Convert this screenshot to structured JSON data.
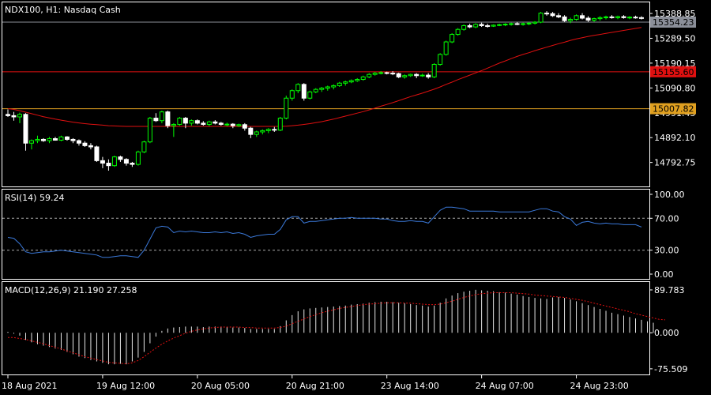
{
  "chart_data": [
    {
      "type": "candlestick",
      "panel": "price",
      "title": "NDX100, H1:  Nasdaq Cash",
      "yrange": [
        14700,
        15430
      ],
      "yticks": [
        "15388.85",
        "15289.50",
        "15190.15",
        "15090.80",
        "14991.45",
        "14892.10",
        "14792.75"
      ],
      "hlines": [
        {
          "label": "15354.23",
          "value": 15354.23,
          "color": "#8b8f99",
          "tag_bg": "#8b8f99",
          "tag_fg": "#000000"
        },
        {
          "label": "15155.60",
          "value": 15155.6,
          "color": "#e01010",
          "tag_bg": "#e01010",
          "tag_fg": "#000000"
        },
        {
          "label": "15007.82",
          "value": 15007.82,
          "color": "#e0a020",
          "tag_bg": "#e0a020",
          "tag_fg": "#000000"
        }
      ],
      "ma_color": "#e01010",
      "candle_up_color": "#00ff00",
      "candle_down_color": "#ffffff",
      "candles_ohlc": [
        [
          14985,
          15005,
          14975,
          14980
        ],
        [
          14980,
          14995,
          14960,
          14975
        ],
        [
          14975,
          14992,
          14950,
          14985
        ],
        [
          14985,
          14990,
          14840,
          14870
        ],
        [
          14870,
          14885,
          14845,
          14880
        ],
        [
          14880,
          14900,
          14870,
          14885
        ],
        [
          14885,
          14890,
          14875,
          14880
        ],
        [
          14880,
          14895,
          14870,
          14888
        ],
        [
          14888,
          14895,
          14880,
          14882
        ],
        [
          14882,
          14900,
          14878,
          14895
        ],
        [
          14895,
          14898,
          14880,
          14885
        ],
        [
          14885,
          14890,
          14870,
          14880
        ],
        [
          14880,
          14885,
          14860,
          14870
        ],
        [
          14870,
          14878,
          14855,
          14860
        ],
        [
          14860,
          14870,
          14845,
          14855
        ],
        [
          14855,
          14860,
          14795,
          14800
        ],
        [
          14800,
          14815,
          14770,
          14790
        ],
        [
          14790,
          14805,
          14760,
          14780
        ],
        [
          14780,
          14820,
          14775,
          14815
        ],
        [
          14815,
          14820,
          14795,
          14805
        ],
        [
          14805,
          14810,
          14780,
          14790
        ],
        [
          14790,
          14795,
          14775,
          14785
        ],
        [
          14785,
          14840,
          14780,
          14835
        ],
        [
          14835,
          14880,
          14830,
          14875
        ],
        [
          14875,
          14975,
          14870,
          14970
        ],
        [
          14970,
          14990,
          14955,
          14960
        ],
        [
          14960,
          15000,
          14950,
          14995
        ],
        [
          14995,
          15000,
          14930,
          14940
        ],
        [
          14940,
          14950,
          14895,
          14945
        ],
        [
          14945,
          14975,
          14940,
          14970
        ],
        [
          14970,
          14975,
          14930,
          14950
        ],
        [
          14950,
          14965,
          14940,
          14960
        ],
        [
          14960,
          14965,
          14945,
          14950
        ],
        [
          14950,
          14958,
          14940,
          14945
        ],
        [
          14945,
          14960,
          14938,
          14955
        ],
        [
          14955,
          14962,
          14945,
          14950
        ],
        [
          14950,
          14955,
          14940,
          14945
        ],
        [
          14945,
          14952,
          14938,
          14946
        ],
        [
          14946,
          14950,
          14930,
          14940
        ],
        [
          14940,
          14948,
          14935,
          14944
        ],
        [
          14944,
          14950,
          14920,
          14930
        ],
        [
          14930,
          14935,
          14890,
          14905
        ],
        [
          14905,
          14920,
          14895,
          14915
        ],
        [
          14915,
          14925,
          14905,
          14920
        ],
        [
          14920,
          14930,
          14910,
          14925
        ],
        [
          14925,
          14935,
          14915,
          14922
        ],
        [
          14922,
          14975,
          14918,
          14970
        ],
        [
          14970,
          15060,
          14965,
          15050
        ],
        [
          15050,
          15085,
          15040,
          15080
        ],
        [
          15080,
          15110,
          15070,
          15105
        ],
        [
          15105,
          15110,
          15040,
          15050
        ],
        [
          15050,
          15080,
          15045,
          15075
        ],
        [
          15075,
          15090,
          15070,
          15085
        ],
        [
          15085,
          15095,
          15075,
          15090
        ],
        [
          15090,
          15100,
          15080,
          15095
        ],
        [
          15095,
          15105,
          15085,
          15100
        ],
        [
          15100,
          15115,
          15095,
          15110
        ],
        [
          15110,
          15120,
          15100,
          15115
        ],
        [
          15115,
          15125,
          15110,
          15120
        ],
        [
          15120,
          15130,
          15115,
          15125
        ],
        [
          15125,
          15140,
          15120,
          15135
        ],
        [
          15135,
          15150,
          15130,
          15145
        ],
        [
          15145,
          15155,
          15140,
          15150
        ],
        [
          15150,
          15158,
          15145,
          15152
        ],
        [
          15152,
          15156,
          15145,
          15150
        ],
        [
          15150,
          15158,
          15142,
          15148
        ],
        [
          15148,
          15152,
          15130,
          15135
        ],
        [
          15135,
          15145,
          15128,
          15140
        ],
        [
          15140,
          15148,
          15135,
          15145
        ],
        [
          15145,
          15150,
          15130,
          15140
        ],
        [
          15140,
          15148,
          15135,
          15142
        ],
        [
          15142,
          15150,
          15128,
          15135
        ],
        [
          15135,
          15190,
          15130,
          15185
        ],
        [
          15185,
          15230,
          15180,
          15225
        ],
        [
          15225,
          15280,
          15220,
          15275
        ],
        [
          15275,
          15310,
          15270,
          15305
        ],
        [
          15305,
          15330,
          15300,
          15325
        ],
        [
          15325,
          15345,
          15320,
          15340
        ],
        [
          15340,
          15348,
          15330,
          15335
        ],
        [
          15335,
          15350,
          15330,
          15345
        ],
        [
          15345,
          15352,
          15335,
          15340
        ],
        [
          15340,
          15348,
          15332,
          15338
        ],
        [
          15338,
          15345,
          15335,
          15342
        ],
        [
          15342,
          15348,
          15338,
          15344
        ],
        [
          15344,
          15350,
          15338,
          15346
        ],
        [
          15346,
          15352,
          15340,
          15348
        ],
        [
          15348,
          15354,
          15342,
          15346
        ],
        [
          15346,
          15352,
          15340,
          15348
        ],
        [
          15348,
          15355,
          15342,
          15350
        ],
        [
          15350,
          15358,
          15345,
          15354
        ],
        [
          15354,
          15395,
          15350,
          15390
        ],
        [
          15390,
          15398,
          15380,
          15388
        ],
        [
          15388,
          15395,
          15375,
          15380
        ],
        [
          15380,
          15390,
          15370,
          15375
        ],
        [
          15375,
          15382,
          15355,
          15360
        ],
        [
          15360,
          15372,
          15350,
          15365
        ],
        [
          15365,
          15385,
          15360,
          15380
        ],
        [
          15380,
          15390,
          15365,
          15370
        ],
        [
          15370,
          15378,
          15355,
          15362
        ],
        [
          15362,
          15372,
          15355,
          15368
        ],
        [
          15368,
          15378,
          15360,
          15372
        ],
        [
          15372,
          15380,
          15365,
          15375
        ],
        [
          15375,
          15382,
          15368,
          15372
        ],
        [
          15372,
          15380,
          15366,
          15376
        ],
        [
          15376,
          15382,
          15368,
          15372
        ],
        [
          15372,
          15378,
          15366,
          15374
        ],
        [
          15374,
          15380,
          15368,
          15372
        ],
        [
          15372,
          15378,
          15365,
          15370
        ]
      ],
      "ma_values": [
        15008,
        15005,
        15000,
        14994,
        14988,
        14982,
        14976,
        14971,
        14966,
        14962,
        14958,
        14954,
        14951,
        14948,
        14946,
        14944,
        14942,
        14940,
        14939,
        14938,
        14937,
        14937,
        14937,
        14937,
        14937,
        14937,
        14937,
        14937,
        14937,
        14937,
        14937,
        14937,
        14937,
        14937,
        14937,
        14937,
        14937,
        14937,
        14937,
        14937,
        14937,
        14937,
        14937,
        14937,
        14937,
        14937,
        14937,
        14938,
        14940,
        14942,
        14945,
        14948,
        14952,
        14956,
        14961,
        14966,
        14972,
        14978,
        14984,
        14990,
        14996,
        15003,
        15010,
        15018,
        15025,
        15032,
        15040,
        15048,
        15056,
        15063,
        15070,
        15078,
        15086,
        15095,
        15105,
        15114,
        15124,
        15133,
        15142,
        15151,
        15160,
        15170,
        15180,
        15190,
        15199,
        15208,
        15217,
        15225,
        15232,
        15240,
        15247,
        15254,
        15261,
        15268,
        15274,
        15281,
        15287,
        15292,
        15297,
        15301,
        15305,
        15309,
        15313,
        15317,
        15321,
        15325,
        15329,
        15333
      ]
    },
    {
      "type": "line",
      "panel": "rsi",
      "title": "RSI(14) 59.24",
      "yrange": [
        0,
        100
      ],
      "yticks": [
        "100.00",
        "70.00",
        "30.00",
        "0.00"
      ],
      "levels": [
        70,
        30
      ],
      "color": "#3a78d8",
      "values": [
        46,
        45,
        38,
        28,
        26,
        27,
        28,
        28,
        29,
        30,
        29,
        28,
        27,
        26,
        25,
        24,
        21,
        21,
        22,
        23,
        23,
        22,
        21,
        30,
        44,
        58,
        60,
        59,
        52,
        54,
        53,
        54,
        53,
        52,
        52,
        53,
        52,
        53,
        51,
        52,
        50,
        46,
        48,
        49,
        50,
        50,
        56,
        68,
        72,
        72,
        64,
        66,
        66,
        67,
        68,
        69,
        70,
        70,
        71,
        70,
        70,
        70,
        70,
        69,
        69,
        67,
        66,
        66,
        67,
        66,
        66,
        64,
        72,
        80,
        84,
        84,
        83,
        82,
        79,
        79,
        79,
        79,
        79,
        78,
        78,
        78,
        78,
        78,
        78,
        80,
        82,
        82,
        79,
        78,
        72,
        69,
        61,
        65,
        66,
        64,
        63,
        64,
        63,
        63,
        62,
        62,
        62,
        59
      ]
    },
    {
      "type": "bar+line",
      "panel": "macd",
      "title": "MACD(12,26,9) 21.190 27.258",
      "yrange": [
        -84,
        98
      ],
      "yticks": [
        "89.783",
        "0.000",
        "-75.509"
      ],
      "hist_color": "#e6e6e6",
      "signal_color": "#e01010",
      "histogram": [
        2,
        -2,
        -6,
        -15,
        -20,
        -24,
        -27,
        -30,
        -33,
        -36,
        -40,
        -45,
        -50,
        -53,
        -57,
        -60,
        -63,
        -66,
        -66,
        -65,
        -66,
        -60,
        -52,
        -40,
        -22,
        -8,
        4,
        9,
        11,
        12,
        13,
        13,
        13,
        12,
        13,
        13,
        13,
        12,
        11,
        11,
        10,
        8,
        8,
        8,
        8,
        8,
        14,
        26,
        37,
        45,
        49,
        51,
        52,
        53,
        54,
        55,
        56,
        57,
        59,
        60,
        61,
        63,
        64,
        65,
        65,
        64,
        63,
        62,
        60,
        58,
        57,
        55,
        57,
        63,
        72,
        78,
        83,
        86,
        88,
        90,
        89,
        88,
        87,
        85,
        84,
        82,
        80,
        77,
        75,
        73,
        72,
        71,
        74,
        75,
        73,
        70,
        66,
        62,
        58,
        54,
        50,
        46,
        42,
        39,
        36,
        33,
        30,
        27,
        24,
        21
      ],
      "signal": [
        -10,
        -10,
        -12,
        -14,
        -17,
        -20,
        -23,
        -27,
        -30,
        -34,
        -38,
        -42,
        -46,
        -50,
        -53,
        -56,
        -59,
        -62,
        -63,
        -64,
        -65,
        -63,
        -58,
        -50,
        -41,
        -32,
        -24,
        -17,
        -11,
        -6,
        -1,
        3,
        6,
        8,
        10,
        11,
        12,
        12,
        12,
        12,
        11,
        11,
        10,
        10,
        10,
        10,
        11,
        14,
        19,
        24,
        29,
        34,
        38,
        42,
        45,
        48,
        51,
        53,
        55,
        57,
        59,
        60,
        61,
        62,
        63,
        63,
        63,
        62,
        62,
        61,
        60,
        59,
        59,
        60,
        63,
        66,
        70,
        74,
        77,
        80,
        82,
        83,
        84,
        84,
        84,
        84,
        83,
        82,
        81,
        79,
        78,
        77,
        76,
        75,
        74,
        72,
        70,
        68,
        65,
        62,
        59,
        56,
        53,
        50,
        47,
        44,
        40,
        37,
        34,
        31,
        28,
        27
      ]
    }
  ],
  "x_axis": {
    "labels": [
      "18 Aug 2021",
      "19 Aug 12:00",
      "20 Aug 05:00",
      "20 Aug 21:00",
      "23 Aug 14:00",
      "24 Aug 07:00",
      "24 Aug 23:00"
    ],
    "label_index": [
      0,
      16,
      32,
      48,
      64,
      80,
      96
    ]
  }
}
